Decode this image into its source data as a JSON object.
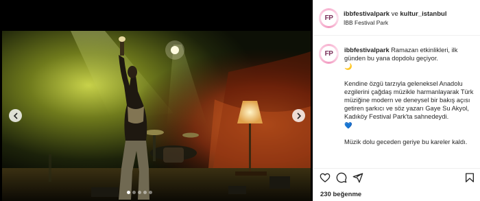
{
  "header": {
    "account1": "ibbfestivalpark",
    "conjunction": "ve",
    "account2": "kultur_istanbul",
    "location": "İBB Festival Park"
  },
  "avatar": {
    "initials": "FP"
  },
  "caption": {
    "user": "ibbfestivalpark",
    "line1": "Ramazan etkinlikleri, ilk günden bu yana dopdolu geçiyor.",
    "moon_emoji": "🌙",
    "para2": "Kendine özgü tarzıyla geleneksel Anadolu ezgilerini çağdaş müzikle harmanlayarak Türk müziğine modern ve deneysel bir bakış açısı getiren şarkıcı ve söz yazarı Gaye Su Akyol, Kadıköy Festival Park'ta sahnedeydi.",
    "heart_emoji": "💙",
    "para3": "Müzik dolu geceden geriye bu kareler kaldı."
  },
  "carousel": {
    "total": 5,
    "active": 0
  },
  "likes": "230 beğenme",
  "icons": {
    "prev": "chevron-left-icon",
    "next": "chevron-right-icon",
    "like": "heart-icon",
    "comment": "comment-icon",
    "share": "share-icon",
    "save": "bookmark-icon"
  },
  "colors": {
    "accent_pink": "#f7b2d0",
    "text": "#262626",
    "divider": "#efefef"
  }
}
